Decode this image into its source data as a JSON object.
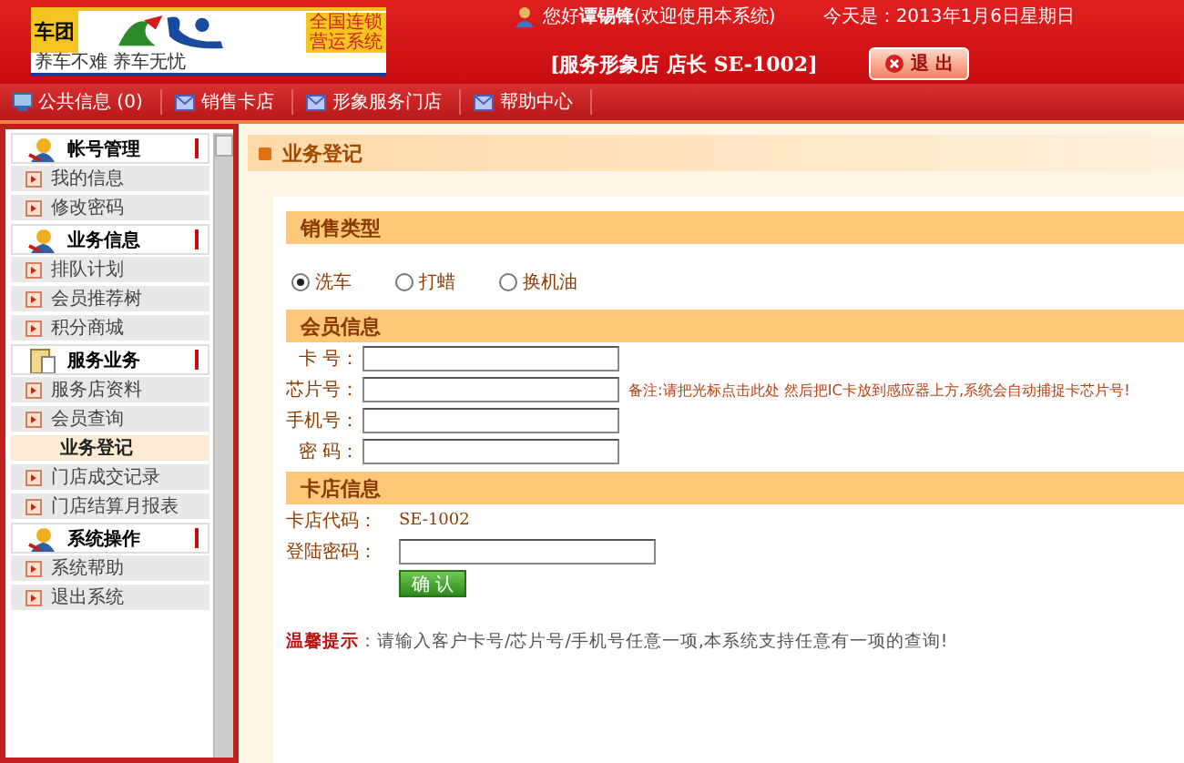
{
  "header": {
    "logo": {
      "brand": "车团",
      "tagline": "养车不难 养车无忧",
      "slogan": [
        "全国连锁",
        "营运系统"
      ]
    },
    "greeting": "您好**谭锡锋**(欢迎使用本系统)",
    "date": "今天是：2013年1月6日星期日",
    "store": "[服务形象店 店长 SE-1002]",
    "logout": "退 出"
  },
  "nav": [
    {
      "label": "公共信息 (0)",
      "kind": "info"
    },
    {
      "label": "销售卡店",
      "kind": "mail"
    },
    {
      "label": "形象服务门店",
      "kind": "mail"
    },
    {
      "label": "帮助中心",
      "kind": "mail"
    }
  ],
  "sidebar": [
    {
      "title": "帐号管理",
      "kind": "user",
      "items": [
        {
          "label": "我的信息",
          "selected": false
        },
        {
          "label": "修改密码",
          "selected": false
        }
      ]
    },
    {
      "title": "业务信息",
      "kind": "user",
      "items": [
        {
          "label": "排队计划",
          "selected": false
        },
        {
          "label": "会员推荐树",
          "selected": false
        },
        {
          "label": "积分商城",
          "selected": false
        }
      ]
    },
    {
      "title": "服务业务",
      "kind": "clipboard",
      "items": [
        {
          "label": "服务店资料",
          "selected": false
        },
        {
          "label": "会员查询",
          "selected": false
        },
        {
          "label": "业务登记",
          "selected": true
        },
        {
          "label": "门店成交记录",
          "selected": false
        },
        {
          "label": "门店结算月报表",
          "selected": false
        }
      ]
    },
    {
      "title": "系统操作",
      "kind": "user",
      "items": [
        {
          "label": "系统帮助",
          "selected": false
        },
        {
          "label": "退出系统",
          "selected": false
        }
      ]
    }
  ],
  "page_title": "业务登记",
  "sale_type": {
    "heading": "销售类型",
    "options": [
      {
        "label": "洗车",
        "selected": true
      },
      {
        "label": "打蜡",
        "selected": false
      },
      {
        "label": "换机油",
        "selected": false
      }
    ]
  },
  "member": {
    "heading": "会员信息",
    "fields": [
      {
        "label": "卡 号："
      },
      {
        "label": "芯片号：",
        "note": "备注:请把光标点击此处 然后把IC卡放到感应器上方,系统会自动捕捉卡芯片号!"
      },
      {
        "label": "手机号："
      },
      {
        "label": "密 码："
      }
    ]
  },
  "shop": {
    "heading": "卡店信息",
    "code_label": "卡店代码：",
    "code": "SE-1002",
    "password_label": "登陆密码：",
    "confirm": "确 认"
  },
  "tip": "**温馨提示**：请输入客户卡号/芯片号/手机号任意一项,本系统支持任意有一项的查询!"
}
